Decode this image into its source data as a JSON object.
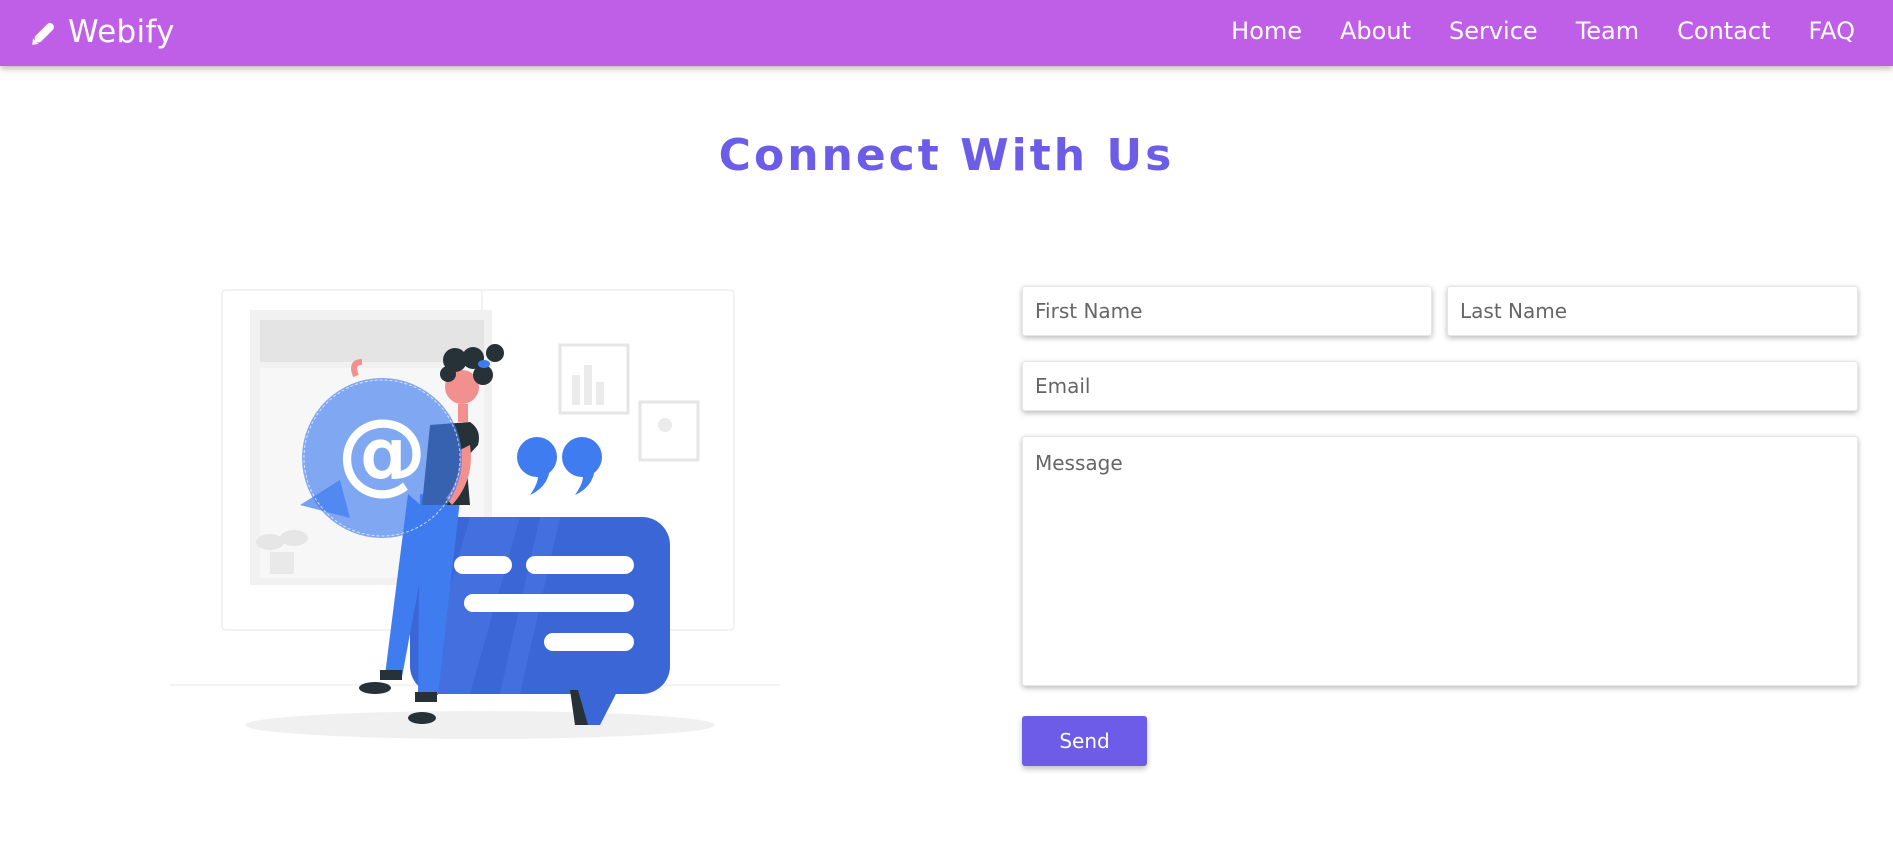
{
  "navbar": {
    "brand_icon": "pencil-icon",
    "brand_text": "Webify",
    "links": [
      {
        "label": "Home"
      },
      {
        "label": "About"
      },
      {
        "label": "Service"
      },
      {
        "label": "Team"
      },
      {
        "label": "Contact"
      },
      {
        "label": "FAQ"
      }
    ]
  },
  "section": {
    "title": "Connect With Us"
  },
  "form": {
    "first_name_placeholder": "First Name",
    "last_name_placeholder": "Last Name",
    "email_placeholder": "Email",
    "message_placeholder": "Message",
    "send_label": "Send"
  },
  "colors": {
    "navbar": "#bf5ee6",
    "accent": "#6c5ce7",
    "illustration_blue": "#3f7cf0"
  }
}
